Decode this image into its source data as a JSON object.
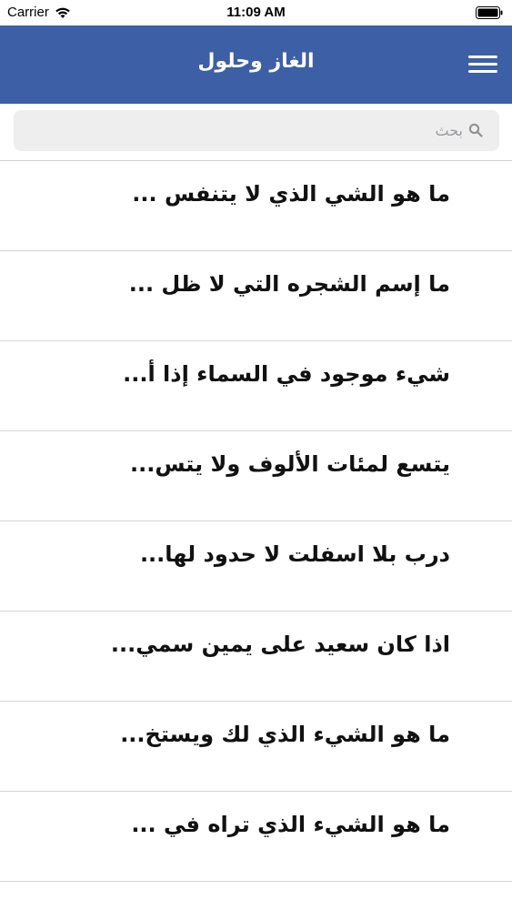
{
  "status_bar": {
    "carrier": "Carrier",
    "time": "11:09 AM"
  },
  "nav": {
    "title": "الغاز وحلول",
    "menu_icon": "hamburger-menu-icon",
    "background_color": "#3d5fa6"
  },
  "search": {
    "placeholder": "بحث",
    "value": ""
  },
  "list": {
    "items": [
      {
        "text": "ما هو الشي الذي لا يتنفس ..."
      },
      {
        "text": "ما إسم الشجره التي لا ظل ..."
      },
      {
        "text": "شيء موجود في السماء إذا أ..."
      },
      {
        "text": "يتسع لمئات الألوف ولا يتس..."
      },
      {
        "text": "درب بلا اسفلت لا حدود لها..."
      },
      {
        "text": "اذا كان سعيد على يمين سمي..."
      },
      {
        "text": "ما هو الشيء الذي لك ويستخ..."
      },
      {
        "text": "ما هو الشيء الذي تراه في ..."
      }
    ]
  }
}
